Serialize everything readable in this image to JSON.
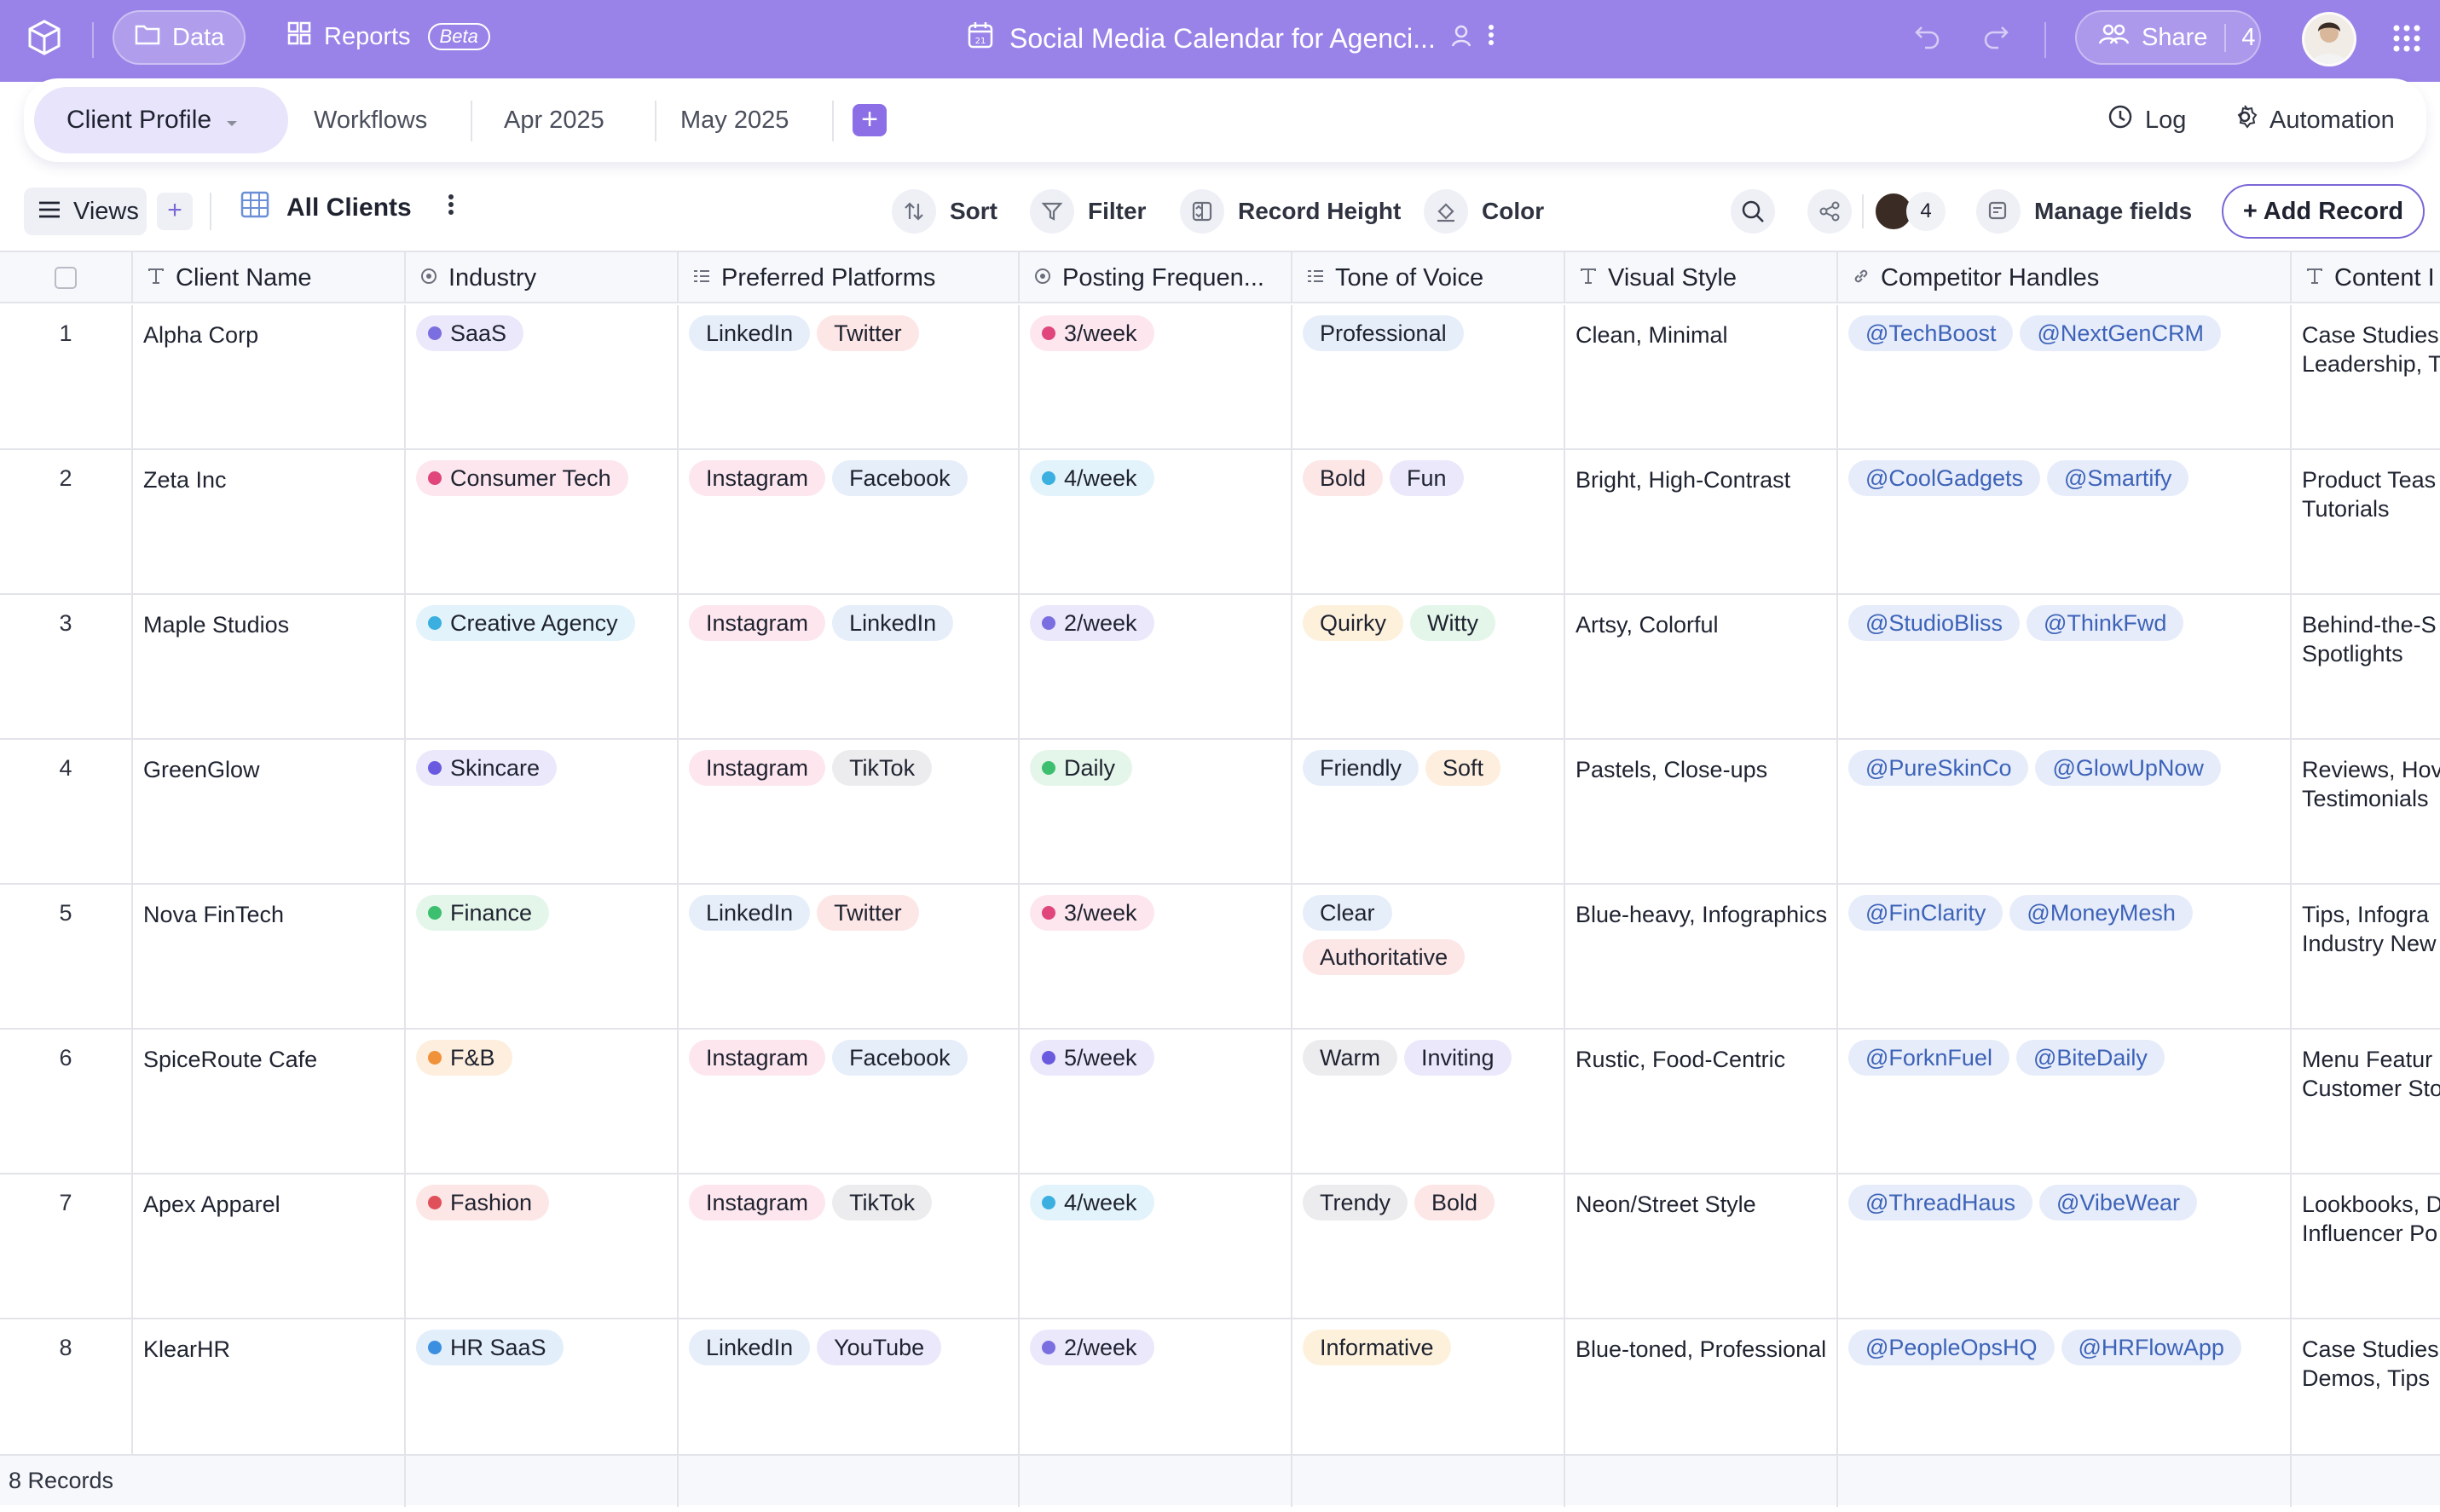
{
  "topbar": {
    "data_label": "Data",
    "reports_label": "Reports",
    "beta_label": "Beta",
    "doc_title": "Social Media Calendar for Agenci...",
    "share_label": "Share",
    "share_count": "4"
  },
  "tabs": {
    "active": "Client Profile",
    "items": [
      "Workflows",
      "Apr 2025",
      "May 2025"
    ],
    "add": "+",
    "log": "Log",
    "automation": "Automation"
  },
  "toolbar": {
    "views": "Views",
    "add": "+",
    "view_name": "All Clients",
    "sort": "Sort",
    "filter": "Filter",
    "record_height": "Record Height",
    "color": "Color",
    "collaborators": "4",
    "manage_fields": "Manage fields",
    "add_record": "+ Add Record"
  },
  "columns": [
    "Client Name",
    "Industry",
    "Preferred Platforms",
    "Posting Frequen...",
    "Tone of Voice",
    "Visual Style",
    "Competitor Handles",
    "Content I"
  ],
  "rows": [
    {
      "num": "1",
      "client": "Alpha Corp",
      "industry": "SaaS",
      "platforms": [
        "LinkedIn",
        "Twitter"
      ],
      "frequency": "3/week",
      "tone": [
        "Professional"
      ],
      "visual": "Clean, Minimal",
      "handles": [
        "@TechBoost",
        "@NextGenCRM"
      ],
      "content": [
        "Case Studies",
        "Leadership, T"
      ]
    },
    {
      "num": "2",
      "client": "Zeta Inc",
      "industry": "Consumer Tech",
      "platforms": [
        "Instagram",
        "Facebook"
      ],
      "frequency": "4/week",
      "tone": [
        "Bold",
        "Fun"
      ],
      "visual": "Bright, High-Contrast",
      "handles": [
        "@CoolGadgets",
        "@Smartify"
      ],
      "content": [
        "Product Teas",
        "Tutorials"
      ]
    },
    {
      "num": "3",
      "client": "Maple Studios",
      "industry": "Creative Agency",
      "platforms": [
        "Instagram",
        "LinkedIn"
      ],
      "frequency": "2/week",
      "tone": [
        "Quirky",
        "Witty"
      ],
      "visual": "Artsy, Colorful",
      "handles": [
        "@StudioBliss",
        "@ThinkFwd"
      ],
      "content": [
        "Behind-the-S",
        "Spotlights"
      ]
    },
    {
      "num": "4",
      "client": "GreenGlow",
      "industry": "Skincare",
      "platforms": [
        "Instagram",
        "TikTok"
      ],
      "frequency": "Daily",
      "tone": [
        "Friendly",
        "Soft"
      ],
      "visual": "Pastels, Close-ups",
      "handles": [
        "@PureSkinCo",
        "@GlowUpNow"
      ],
      "content": [
        "Reviews, Hov",
        "Testimonials"
      ]
    },
    {
      "num": "5",
      "client": "Nova FinTech",
      "industry": "Finance",
      "platforms": [
        "LinkedIn",
        "Twitter"
      ],
      "frequency": "3/week",
      "tone": [
        "Clear",
        "Authoritative"
      ],
      "visual": "Blue-heavy, Infographics",
      "handles": [
        "@FinClarity",
        "@MoneyMesh"
      ],
      "content": [
        "Tips, Infogra",
        "Industry New"
      ]
    },
    {
      "num": "6",
      "client": "SpiceRoute Cafe",
      "industry": "F&B",
      "platforms": [
        "Instagram",
        "Facebook"
      ],
      "frequency": "5/week",
      "tone": [
        "Warm",
        "Inviting"
      ],
      "visual": "Rustic, Food-Centric",
      "handles": [
        "@ForknFuel",
        "@BiteDaily"
      ],
      "content": [
        "Menu Featur",
        "Customer Sto"
      ]
    },
    {
      "num": "7",
      "client": "Apex Apparel",
      "industry": "Fashion",
      "platforms": [
        "Instagram",
        "TikTok"
      ],
      "frequency": "4/week",
      "tone": [
        "Trendy",
        "Bold"
      ],
      "visual": "Neon/Street Style",
      "handles": [
        "@ThreadHaus",
        "@VibeWear"
      ],
      "content": [
        "Lookbooks, D",
        "Influencer Po"
      ]
    },
    {
      "num": "8",
      "client": "KlearHR",
      "industry": "HR SaaS",
      "platforms": [
        "LinkedIn",
        "YouTube"
      ],
      "frequency": "2/week",
      "tone": [
        "Informative"
      ],
      "visual": "Blue-toned, Professional",
      "handles": [
        "@PeopleOpsHQ",
        "@HRFlowApp"
      ],
      "content": [
        "Case Studies",
        "Demos, Tips"
      ]
    }
  ],
  "footer": {
    "count": "8 Records"
  },
  "colors": {
    "header": "#9a83e8",
    "industry_dots": {
      "SaaS": "#7b6ee0",
      "Consumer Tech": "#e0457b",
      "Creative Agency": "#3bb0e0",
      "Skincare": "#6a5ae0",
      "Finance": "#3cbf6e",
      "F&B": "#f0923a",
      "Fashion": "#e0505a",
      "HR SaaS": "#3a8fe0"
    },
    "industry_bg": {
      "SaaS": "#ebe8fb",
      "Consumer Tech": "#fde6ee",
      "Creative Agency": "#e3f3fb",
      "Skincare": "#ebe8fb",
      "Finance": "#e4f6ea",
      "F&B": "#fdeedd",
      "Fashion": "#fde6e6",
      "HR SaaS": "#e3eefb"
    },
    "platform_bg": {
      "LinkedIn": "#e6eefa",
      "Twitter": "#fde6e6",
      "Instagram": "#fde6ee",
      "Facebook": "#e6eefa",
      "TikTok": "#ececef",
      "YouTube": "#ebe8fb"
    },
    "frequency_dots": {
      "3/week": "#e0457b",
      "4/week": "#3bb0e0",
      "2/week": "#7b6ee0",
      "Daily": "#3cbf6e",
      "5/week": "#6a5ae0"
    },
    "frequency_bg": {
      "3/week": "#fde6ee",
      "4/week": "#e3f3fb",
      "2/week": "#ebe8fb",
      "Daily": "#e4f6ea",
      "5/week": "#ebe8fb"
    },
    "tone_bg": {
      "Professional": "#e6eefa",
      "Bold": "#fde6e6",
      "Fun": "#ebe8fb",
      "Quirky": "#fdf1dc",
      "Witty": "#e4f6ea",
      "Friendly": "#e6eefa",
      "Soft": "#fdeedd",
      "Clear": "#e6eefa",
      "Authoritative": "#fde6e6",
      "Warm": "#ececef",
      "Inviting": "#ebe8fb",
      "Trendy": "#ececef",
      "Informative": "#fdf1dc"
    }
  },
  "icons": [
    "logo-icon",
    "folder-icon",
    "grid-icon",
    "calendar-icon",
    "person-icon",
    "more-icon",
    "undo-icon",
    "redo-icon",
    "people-icon",
    "apps-icon",
    "clock-icon",
    "gear-icon",
    "menu-icon",
    "table-icon",
    "sort-icon",
    "filter-icon",
    "height-icon",
    "paint-icon",
    "search-icon",
    "share-link-icon",
    "fields-icon"
  ]
}
